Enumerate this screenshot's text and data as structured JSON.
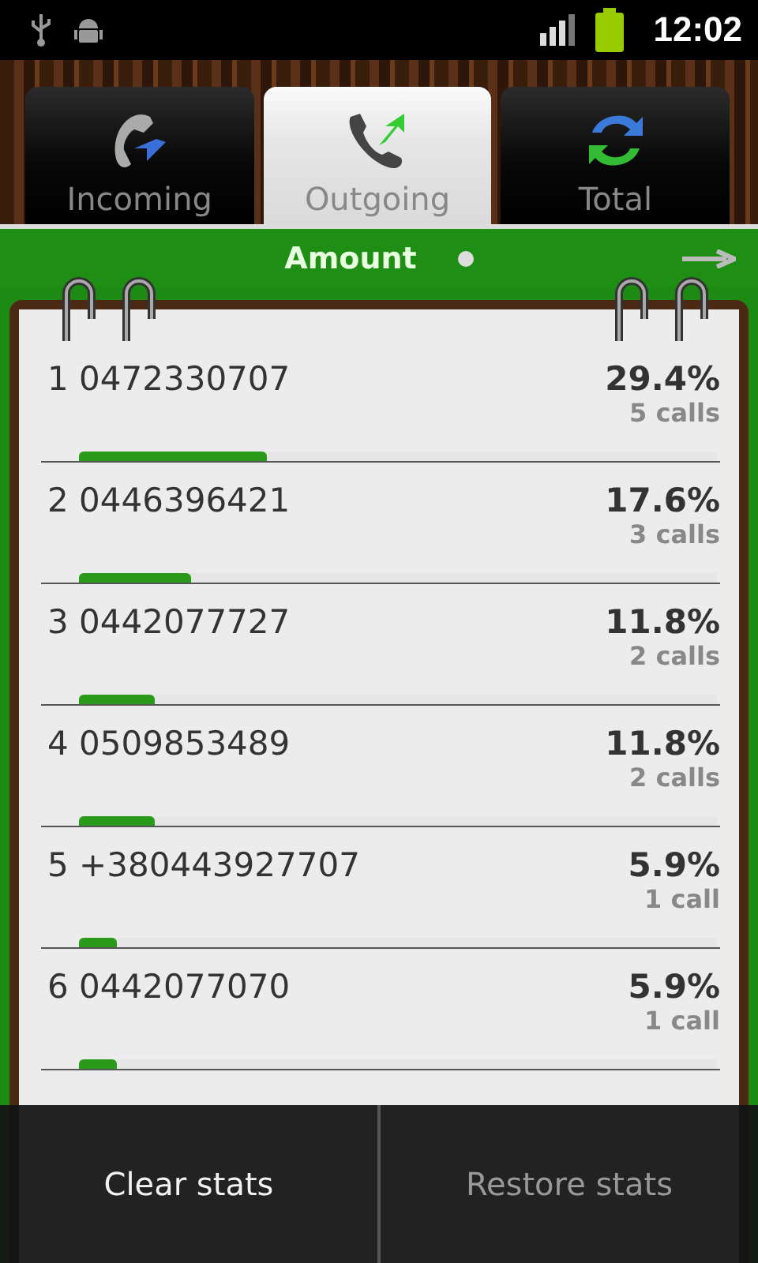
{
  "status_bar": {
    "time": "12:02"
  },
  "tabs": [
    {
      "label": "Incoming",
      "selected": false,
      "kind": "incoming"
    },
    {
      "label": "Outgoing",
      "selected": true,
      "kind": "outgoing"
    },
    {
      "label": "Total",
      "selected": false,
      "kind": "total"
    }
  ],
  "header": {
    "title": "Amount"
  },
  "rows": [
    {
      "rank": "1",
      "number": "0472330707",
      "percent": "29.4%",
      "calls": "5 calls",
      "level": 0.294
    },
    {
      "rank": "2",
      "number": "0446396421",
      "percent": "17.6%",
      "calls": "3 calls",
      "level": 0.176
    },
    {
      "rank": "3",
      "number": "0442077727",
      "percent": "11.8%",
      "calls": "2 calls",
      "level": 0.118
    },
    {
      "rank": "4",
      "number": "0509853489",
      "percent": "11.8%",
      "calls": "2 calls",
      "level": 0.118
    },
    {
      "rank": "5",
      "number": "+380443927707",
      "percent": "5.9%",
      "calls": "1 call",
      "level": 0.059
    },
    {
      "rank": "6",
      "number": "0442077070",
      "percent": "5.9%",
      "calls": "1 call",
      "level": 0.059
    }
  ],
  "menu": [
    {
      "label": "Clear stats",
      "disabled": false
    },
    {
      "label": "Restore stats",
      "disabled": true
    }
  ]
}
